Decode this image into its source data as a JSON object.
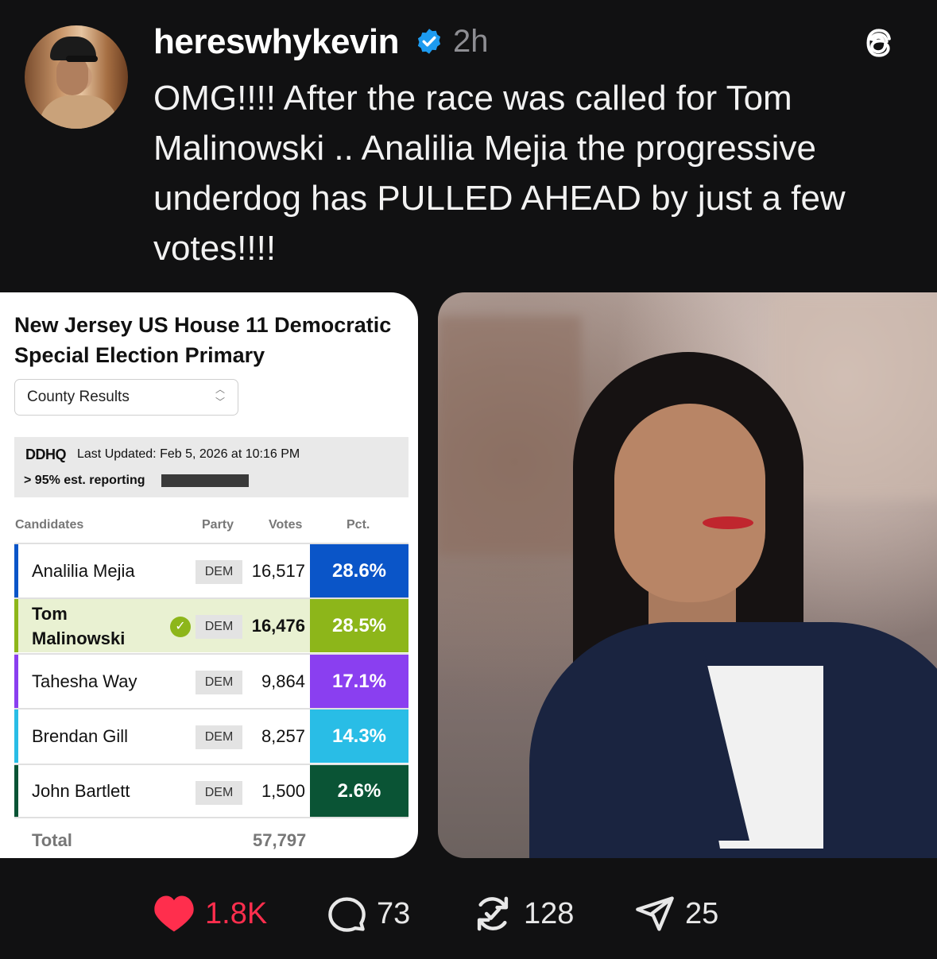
{
  "post": {
    "username": "hereswhykevin",
    "time_ago": "2h",
    "caption": "OMG!!!! After the race was called for Tom Malinowski .. Analilia Mejia the progressive underdog has PULLED AHEAD by just a few votes!!!!"
  },
  "card": {
    "title": "New Jersey US House 11 Democratic Special Election Primary",
    "select_value": "County Results",
    "source_logo_text": "DDHQ",
    "last_updated": "Last Updated: Feb 5, 2026 at 10:16 PM",
    "reporting": "> 95% est. reporting",
    "reporting_fraction": 0.95,
    "headers": {
      "candidates": "Candidates",
      "party": "Party",
      "votes": "Votes",
      "pct": "Pct."
    },
    "rows": [
      {
        "name": "Analilia Mejia",
        "party": "DEM",
        "votes": "16,517",
        "pct": "28.6%",
        "color": "#0a55c8"
      },
      {
        "name": "Tom Malinowski",
        "party": "DEM",
        "votes": "16,476",
        "pct": "28.5%",
        "color": "#8db61a"
      },
      {
        "name": "Tahesha Way",
        "party": "DEM",
        "votes": "9,864",
        "pct": "17.1%",
        "color": "#8a3ff0"
      },
      {
        "name": "Brendan Gill",
        "party": "DEM",
        "votes": "8,257",
        "pct": "14.3%",
        "color": "#29bde6"
      },
      {
        "name": "John Bartlett",
        "party": "DEM",
        "votes": "1,500",
        "pct": "2.6%",
        "color": "#0a5435"
      }
    ],
    "total_label": "Total",
    "total_votes": "57,797"
  },
  "actions": {
    "likes": "1.8K",
    "comments": "73",
    "reposts": "128",
    "shares": "25"
  },
  "colors": {
    "background": "#111112",
    "like_red": "#ff2e4d",
    "verified_blue": "#1d9bf0"
  }
}
